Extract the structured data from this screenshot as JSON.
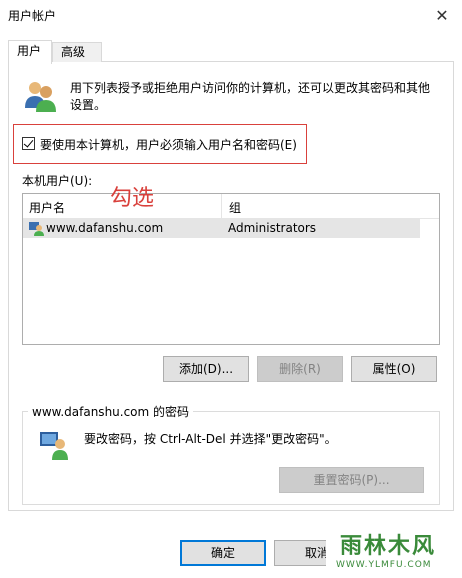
{
  "window": {
    "title": "用户帐户"
  },
  "tabs": [
    {
      "label": "用户"
    },
    {
      "label": "高级"
    }
  ],
  "intro": "用下列表授予或拒绝用户访问你的计算机，还可以更改其密码和其他设置。",
  "checkbox": {
    "label": "要使用本计算机，用户必须输入用户名和密码(E)",
    "checked": true
  },
  "annotation": "勾选",
  "local_users": {
    "label": "本机用户(U):",
    "columns": [
      "用户名",
      "组"
    ],
    "rows": [
      {
        "name": "www.dafanshu.com",
        "group": "Administrators"
      }
    ]
  },
  "buttons": {
    "add": "添加(D)...",
    "delete": "删除(R)",
    "properties": "属性(O)"
  },
  "password_group": {
    "legend": "www.dafanshu.com 的密码",
    "text": "要改密码，按 Ctrl-Alt-Del 并选择\"更改密码\"。",
    "reset": "重置密码(P)..."
  },
  "footer": {
    "ok": "确定",
    "cancel": "取消"
  },
  "watermark": {
    "brand": "雨林木风",
    "url": "WWW.YLMFU.COM"
  },
  "colors": {
    "highlight": "#d9413c",
    "focus": "#0078d7",
    "brand": "#3a8a3a"
  }
}
